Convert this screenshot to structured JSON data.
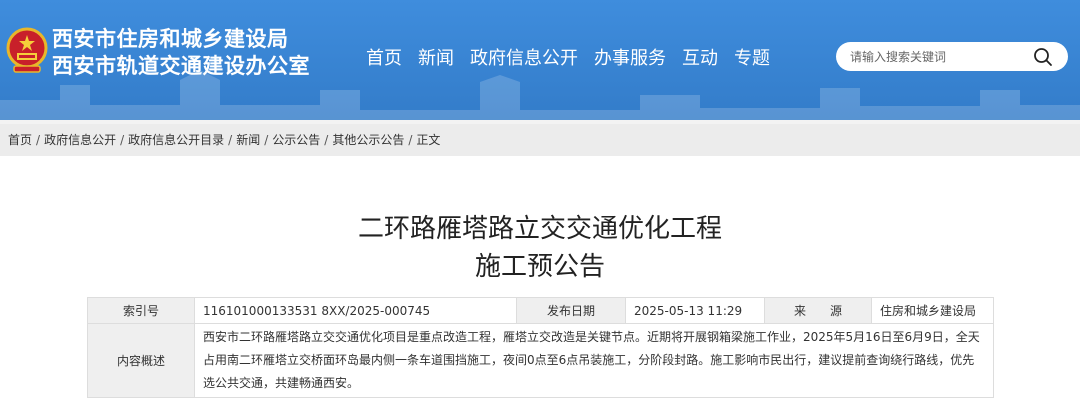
{
  "header": {
    "title_line1": "西安市住房和城乡建设局",
    "title_line2": "西安市轨道交通建设办公室",
    "nav": [
      "首页",
      "新闻",
      "政府信息公开",
      "办事服务",
      "互动",
      "专题"
    ],
    "search_placeholder": "请输入搜索关键词",
    "brand_color": "#3b86d6"
  },
  "breadcrumb": [
    "首页",
    "政府信息公开",
    "政府信息公开目录",
    "新闻",
    "公示公告",
    "其他公示公告",
    "正文"
  ],
  "breadcrumb_separator": "/",
  "article": {
    "title_line1": "二环路雁塔路立交交通优化工程",
    "title_line2": "施工预公告",
    "meta": {
      "index_label": "索引号",
      "index_value": "116101000133531 8XX/2025-000745",
      "date_label": "发布日期",
      "date_value": "2025-05-13 11:29",
      "source_label": "来　　源",
      "source_value": "住房和城乡建设局",
      "summary_label": "内容概述",
      "summary_text": "西安市二环路雁塔路立交交通优化项目是重点改造工程，雁塔立交改造是关键节点。近期将开展钢箱梁施工作业，2025年5月16日至6月9日，全天占用南二环雁塔立交桥面环岛最内侧一条车道围挡施工，夜间0点至6点吊装施工，分阶段封路。施工影响市民出行，建议提前查询绕行路线，优先选公共交通，共建畅通西安。"
    }
  },
  "icons": {
    "emblem": "national-emblem-icon",
    "search": "search-icon"
  }
}
